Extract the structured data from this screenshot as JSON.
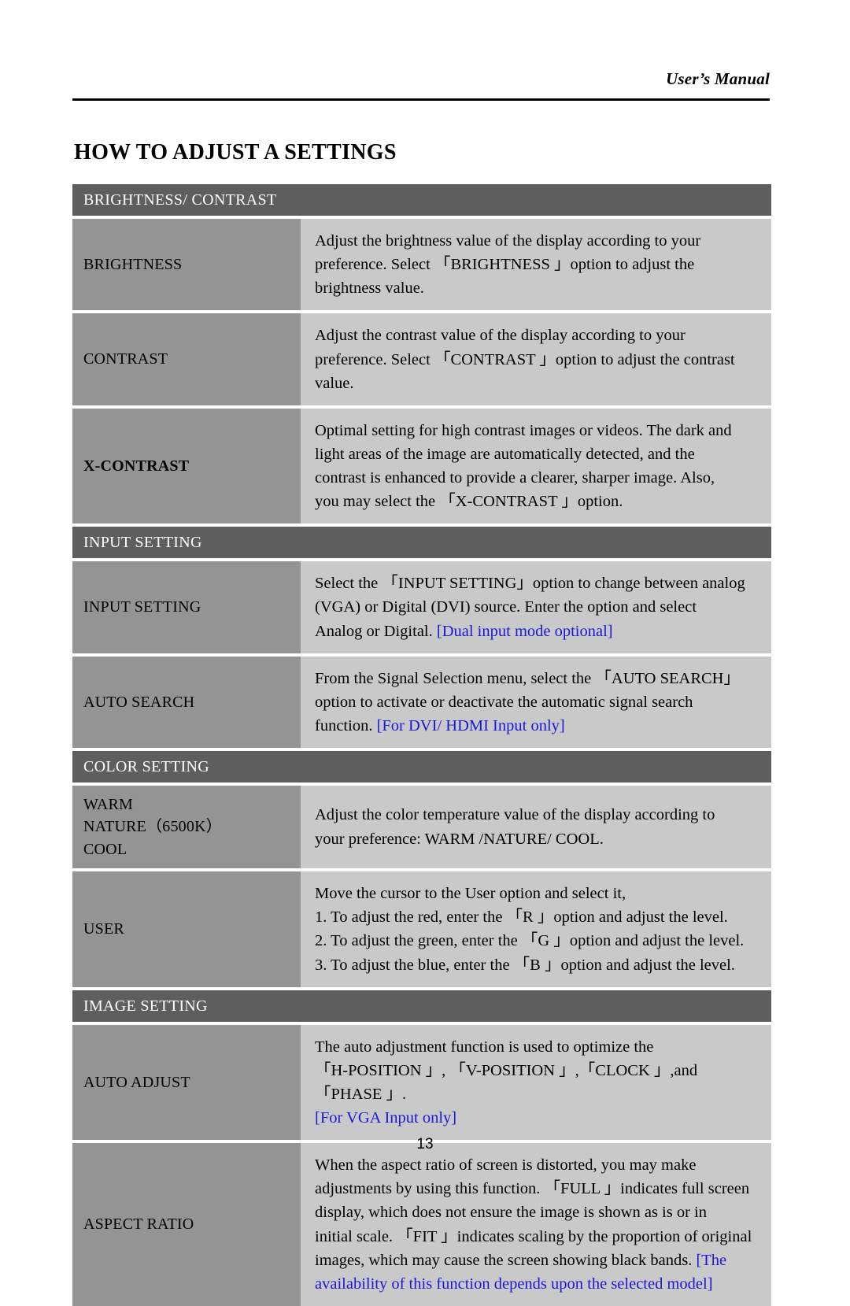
{
  "header": {
    "running_title": "User’s Manual"
  },
  "page_title": "HOW TO ADJUST A SETTINGS",
  "footer": {
    "page_number": "13"
  },
  "colors": {
    "section_header_bg": "#5e5e5e",
    "label_cell_bg": "#949494",
    "desc_cell_bg": "#c9c9c9",
    "note_blue": "#1919d6",
    "text": "#000000",
    "section_header_text": "#ffffff",
    "page_bg": "#ffffff"
  },
  "sections": [
    {
      "title": "BRIGHTNESS/ CONTRAST",
      "rows": [
        {
          "label_lines": [
            "BRIGHTNESS"
          ],
          "label_bold": false,
          "desc_lines": [
            "Adjust the brightness value of the display according to your",
            "preference. Select 「BRIGHTNESS 」option to adjust the",
            "brightness value."
          ]
        },
        {
          "label_lines": [
            "CONTRAST"
          ],
          "label_bold": false,
          "desc_lines": [
            "Adjust the contrast value of the display according to your",
            "preference. Select 「CONTRAST 」option to adjust the contrast",
            "value."
          ]
        },
        {
          "label_lines": [
            "X-CONTRAST"
          ],
          "label_bold": true,
          "desc_lines": [
            "Optimal setting for high contrast images or videos. The dark and",
            "light areas of the image are automatically detected, and the",
            "contrast is enhanced to provide a clearer, sharper image. Also,",
            "you may select the 「X-CONTRAST 」option."
          ]
        }
      ]
    },
    {
      "title": "INPUT SETTING",
      "rows": [
        {
          "label_lines": [
            "INPUT SETTING"
          ],
          "label_bold": false,
          "desc_lines": [
            "Select the 「INPUT SETTING」option to change between analog",
            "(VGA) or Digital (DVI) source. Enter the option and select",
            "Analog or Digital. [Dual input mode optional]"
          ],
          "note": "[Dual input mode optional]"
        },
        {
          "label_lines": [
            "AUTO SEARCH"
          ],
          "label_bold": false,
          "desc_lines": [
            "From the Signal Selection menu, select the 「AUTO SEARCH」",
            "option to activate or deactivate the automatic signal search",
            "function. [For DVI/ HDMI Input only]"
          ],
          "note": "[For DVI/ HDMI Input only]"
        }
      ]
    },
    {
      "title": "COLOR SETTING",
      "rows": [
        {
          "label_lines": [
            "WARM",
            "NATURE（6500K）",
            "COOL"
          ],
          "label_bold": false,
          "desc_lines": [
            "Adjust the color temperature value of the display according to",
            "your preference: WARM /NATURE/ COOL."
          ]
        },
        {
          "label_lines": [
            "USER"
          ],
          "label_bold": false,
          "desc_lines": [
            "Move the cursor to the User option and select it,",
            "1. To adjust the red, enter the 「R 」option and adjust the level.",
            "2. To adjust the green, enter the 「G 」option and adjust the level.",
            "3. To adjust the blue, enter the 「B 」option and adjust the level."
          ]
        }
      ]
    },
    {
      "title": "IMAGE SETTING",
      "rows": [
        {
          "label_lines": [
            "AUTO ADJUST"
          ],
          "label_bold": false,
          "desc_lines": [
            "The auto adjustment function is used to optimize the",
            "「H-POSITION 」, 「V-POSITION 」,「CLOCK 」,and 「PHASE 」.",
            "[For VGA Input only]"
          ],
          "note": "[For VGA Input only]"
        },
        {
          "label_lines": [
            "ASPECT RATIO"
          ],
          "label_bold": false,
          "desc_lines": [
            "When the aspect ratio of screen is distorted, you may make",
            "adjustments by using this function. 「FULL 」indicates full screen",
            "display, which does not ensure the image is shown as is or in",
            "initial scale. 「FIT 」indicates scaling by the proportion of original",
            "images, which may cause the screen showing black bands. [The",
            "availability of this function depends upon the selected model]"
          ],
          "note": "[The availability of this function depends upon the selected model]"
        }
      ]
    }
  ]
}
